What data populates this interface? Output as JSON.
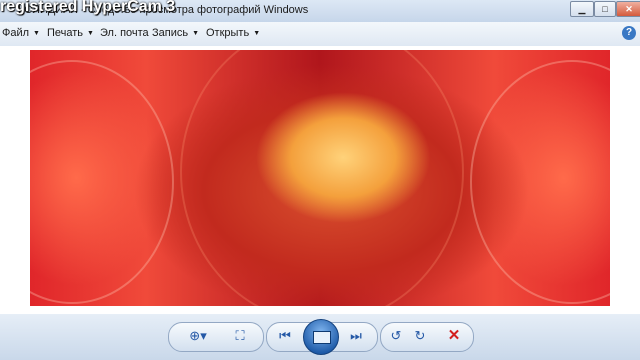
{
  "window": {
    "title": "КОЛИДИАЛ - Средство просмотра фотографий Windows",
    "watermark": "registered HyperCam 3",
    "controls": [
      "minimize",
      "maximize",
      "close"
    ]
  },
  "menu": {
    "items": [
      {
        "label": "Файл"
      },
      {
        "label": "Печать"
      },
      {
        "label": "Эл. почта"
      },
      {
        "label": "Запись"
      },
      {
        "label": "Открыть"
      }
    ],
    "help_icon": "help-icon"
  },
  "photo": {
    "subject": "rose-in-hands-image"
  },
  "toolbar": {
    "buttons": [
      {
        "name": "zoom-button",
        "icon": "magnifier-icon"
      },
      {
        "name": "actual-size-button",
        "icon": "fit-window-icon"
      },
      {
        "name": "previous-button",
        "icon": "skip-back-icon"
      },
      {
        "name": "slideshow-button",
        "icon": "slideshow-icon"
      },
      {
        "name": "next-button",
        "icon": "skip-forward-icon"
      },
      {
        "name": "rotate-left-button",
        "icon": "rotate-ccw-icon"
      },
      {
        "name": "rotate-right-button",
        "icon": "rotate-cw-icon"
      },
      {
        "name": "delete-button",
        "icon": "delete-x-icon"
      }
    ]
  },
  "colors": {
    "accent": "#2458a6",
    "delete": "#d21e1e",
    "photo_main": "#e0262a"
  }
}
